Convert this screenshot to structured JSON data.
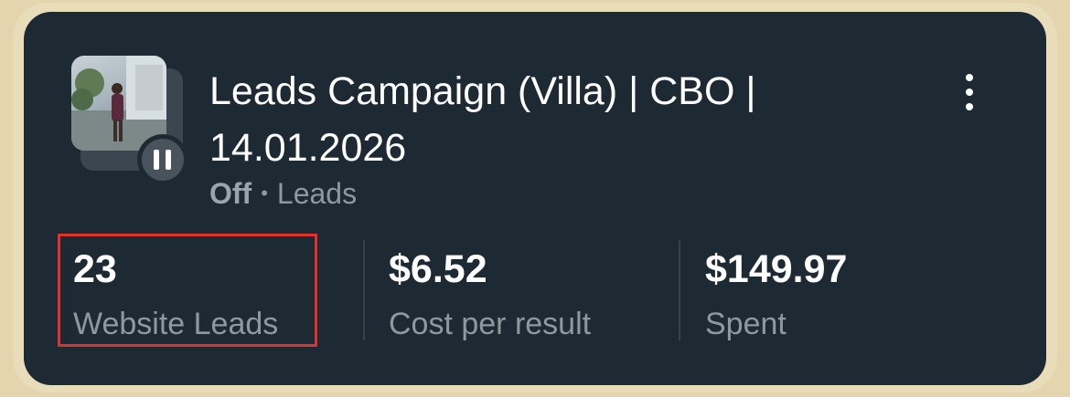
{
  "campaign": {
    "title": "Leads Campaign (Villa) | CBO | 14.01.2026",
    "status": "Off",
    "separator": "•",
    "objective": "Leads"
  },
  "metrics": [
    {
      "value": "23",
      "label": "Website Leads"
    },
    {
      "value": "$6.52",
      "label": "Cost per result"
    },
    {
      "value": "$149.97",
      "label": "Spent"
    }
  ],
  "icons": {
    "pause": "pause-icon",
    "menu": "more-vertical-icon"
  },
  "colors": {
    "card_background": "#1e2a33",
    "frame_background": "#e8dcb9",
    "highlight_border": "#e0322c",
    "muted_text": "#8e989f"
  }
}
